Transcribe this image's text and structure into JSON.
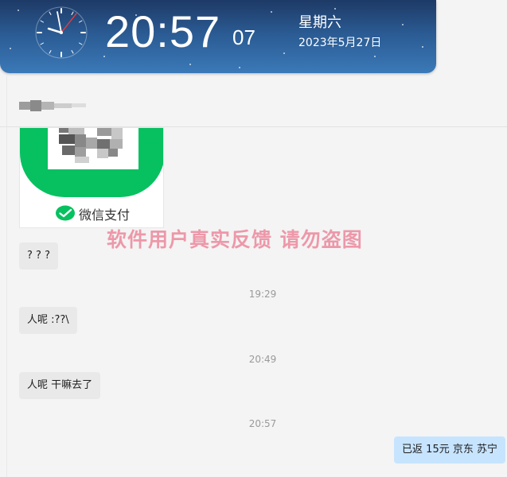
{
  "clock": {
    "time_main": "20:57",
    "time_seconds": "07",
    "weekday": "星期六",
    "date": "2023年5月27日"
  },
  "pay_card": {
    "label": "微信支付",
    "brand_color": "#07c160"
  },
  "watermark": "软件用户真实反馈  请勿盗图",
  "messages": [
    {
      "text": "? ? ?"
    },
    {
      "time": "19:29"
    },
    {
      "text": "人呢 :??\\"
    },
    {
      "time": "20:49"
    },
    {
      "text": "人呢 干嘛去了"
    },
    {
      "time": "20:57"
    },
    {
      "text": "已返 15元  京东  苏宁"
    }
  ],
  "colors": {
    "banner_top": "#1e3a66",
    "banner_bottom": "#3b79b8",
    "incoming_bubble": "#e9e9e9",
    "outgoing_bubble": "#c7e4ff",
    "watermark": "#e85f7a"
  }
}
